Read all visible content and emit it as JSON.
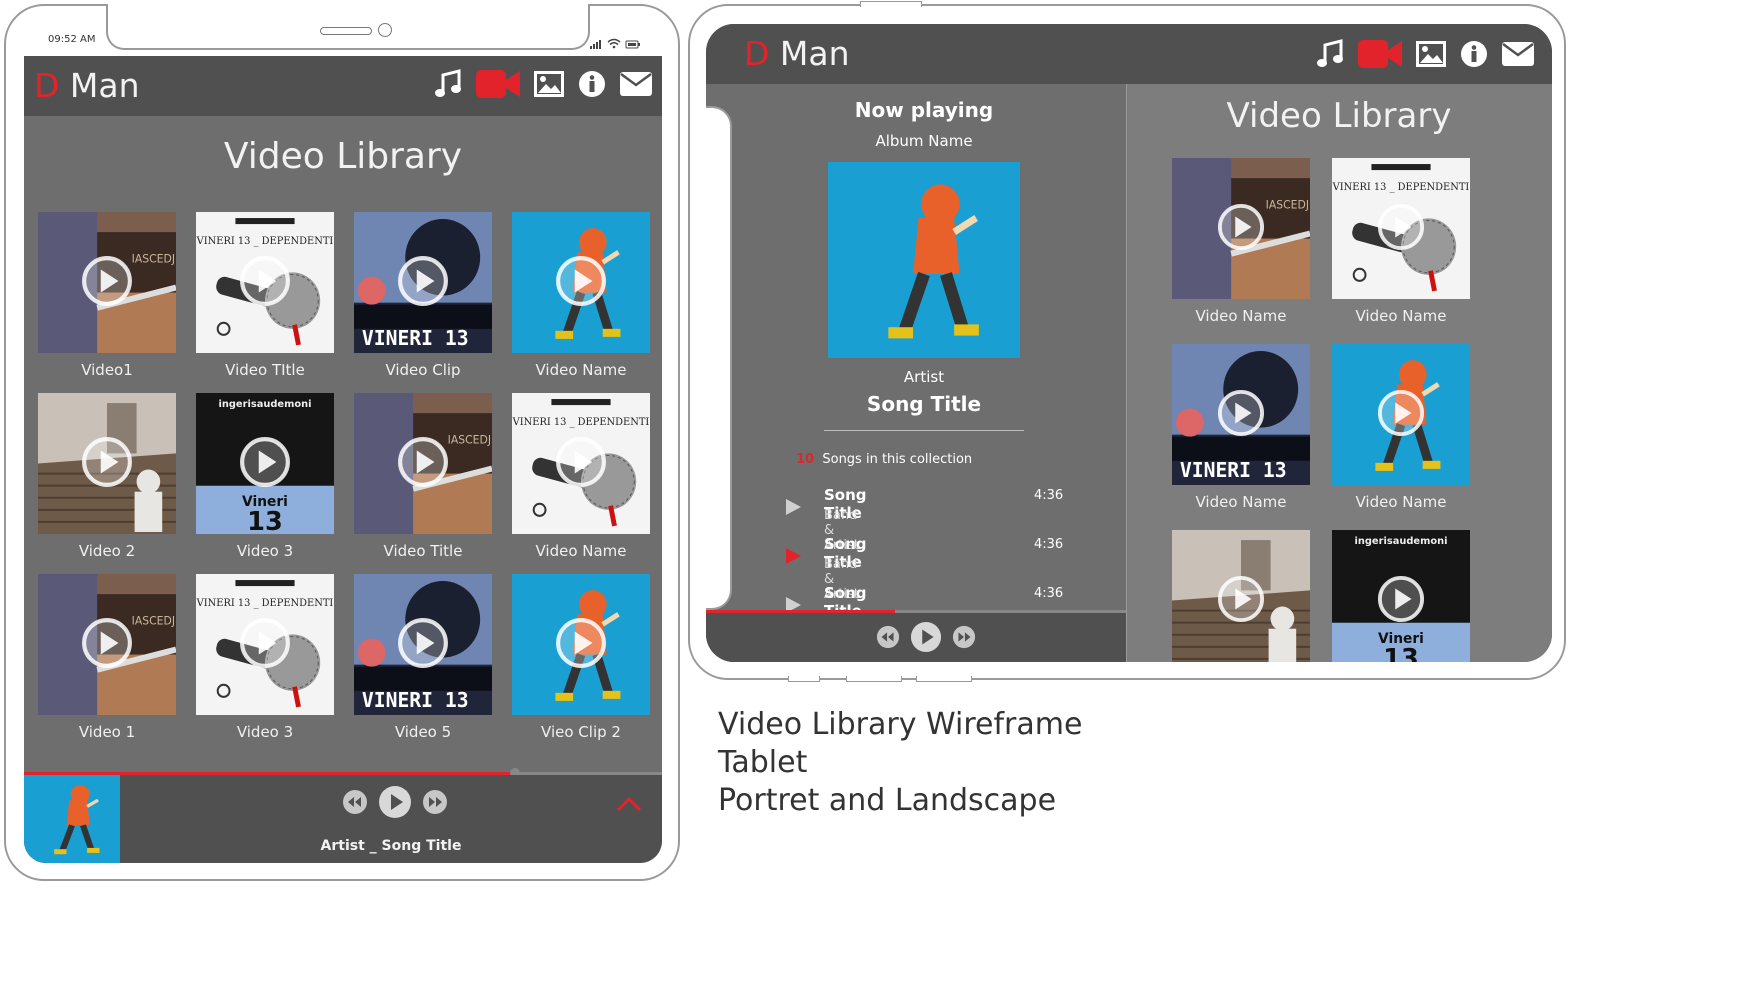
{
  "portrait": {
    "status_time": "09:52 AM",
    "app": {
      "logo_d": "D",
      "logo_text": "Man"
    },
    "nav_icons": [
      "music-icon",
      "video-icon",
      "image-icon",
      "info-icon",
      "mail-icon"
    ],
    "library_title": "Video Library",
    "videos": [
      {
        "caption": "Video1",
        "art": "piano"
      },
      {
        "caption": "Video TItle",
        "art": "mic"
      },
      {
        "caption": "Video Clip",
        "art": "vineri"
      },
      {
        "caption": "Video Name",
        "art": "walker"
      },
      {
        "caption": "Video 2",
        "art": "stairs"
      },
      {
        "caption": "Video 3",
        "art": "vineri13"
      },
      {
        "caption": "Video Title",
        "art": "piano"
      },
      {
        "caption": "Video Name",
        "art": "mic"
      },
      {
        "caption": "Video 1",
        "art": "piano"
      },
      {
        "caption": "Video 3",
        "art": "mic"
      },
      {
        "caption": "Video 5",
        "art": "vineri"
      },
      {
        "caption": "Vieo Clip 2",
        "art": "walker"
      }
    ],
    "player": {
      "now_playing": "Artist _ Song Title",
      "progress": 0.77
    }
  },
  "landscape": {
    "app": {
      "logo_d": "D",
      "logo_text": "Man"
    },
    "now_playing": {
      "heading": "Now playing",
      "album": "Album Name",
      "artist": "Artist",
      "song": "Song Title",
      "count": "10",
      "count_label": "Songs in this collection",
      "progress": 0.45
    },
    "tracks": [
      {
        "title": "Song Title",
        "artist": "Band & Artist",
        "time": "4:36",
        "active": false
      },
      {
        "title": "Song Title",
        "artist": "Band & Artist",
        "time": "4:36",
        "active": true
      },
      {
        "title": "Song Title",
        "artist": "",
        "time": "4:36",
        "active": false
      }
    ],
    "library_title": "Video Library",
    "videos": [
      {
        "caption": "Video Name",
        "art": "piano"
      },
      {
        "caption": "Video Name",
        "art": "mic"
      },
      {
        "caption": "Video Name",
        "art": "vineri"
      },
      {
        "caption": "Video Name",
        "art": "walker"
      },
      {
        "caption": "",
        "art": "stairs"
      },
      {
        "caption": "",
        "art": "vineri13"
      }
    ]
  },
  "caption": {
    "line1": "Video Library Wireframe",
    "line2": "Tablet",
    "line3": "Portret and Landscape"
  },
  "colors": {
    "accent": "#e3232c",
    "bar": "#505050",
    "panel": "#6e6e6e",
    "panel_light": "#7d7d7d",
    "art_blue": "#1a9fd3"
  }
}
